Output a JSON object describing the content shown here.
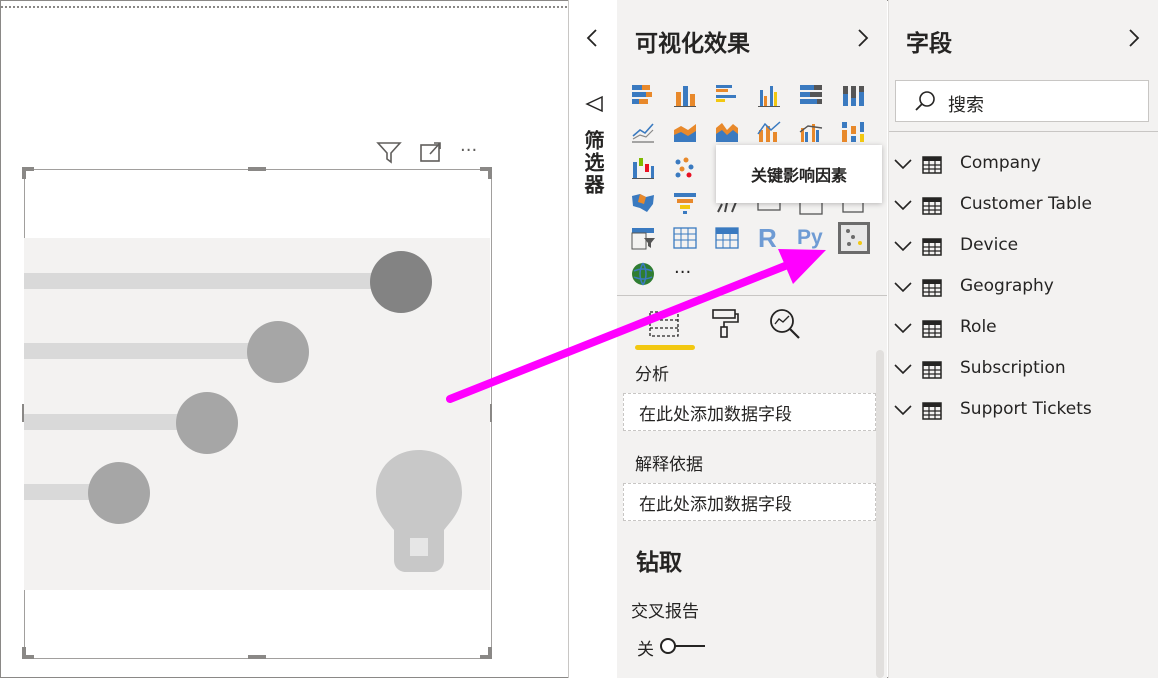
{
  "visualizations": {
    "title": "可视化效果",
    "tooltip": "关键影响因素",
    "r_label": "R",
    "py_label": "Py",
    "more_label": "···"
  },
  "filters": {
    "label": "筛选器"
  },
  "wells": {
    "analyze_label": "分析",
    "analyze_placeholder": "在此处添加数据字段",
    "explain_by_label": "解释依据",
    "explain_by_placeholder": "在此处添加数据字段"
  },
  "drillthrough": {
    "title": "钻取",
    "cross_report_label": "交叉报告",
    "toggle_state": "关"
  },
  "fields": {
    "title": "字段",
    "search_placeholder": "搜索",
    "tables": [
      "Company",
      "Customer Table",
      "Device",
      "Geography",
      "Role",
      "Subscription",
      "Support Tickets"
    ]
  },
  "visual_header": {
    "more_label": "···"
  },
  "colors": {
    "accent_yellow": "#f2c811",
    "arrow_magenta": "#ff00ff",
    "pane_bg": "#f3f2f1"
  }
}
